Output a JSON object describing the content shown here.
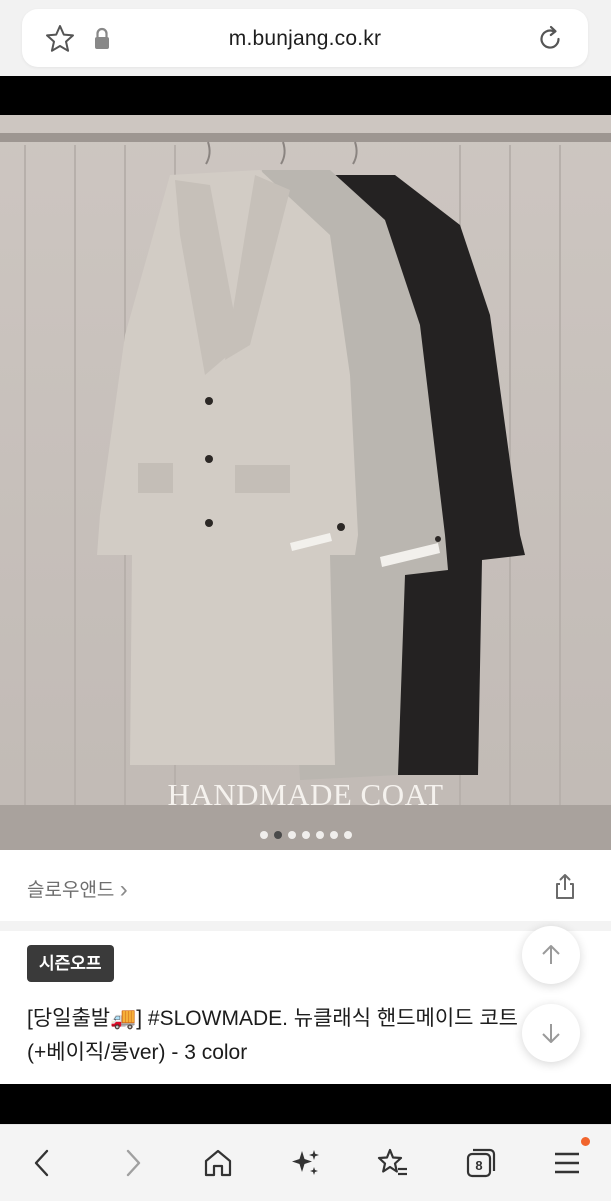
{
  "browser": {
    "url": "m.bunjang.co.kr",
    "tab_count": "8"
  },
  "hero": {
    "caption": "HANDMADE COAT",
    "slide_count": 7,
    "active_slide_index": 1
  },
  "shop": {
    "name": "슬로우앤드",
    "chevron": "›"
  },
  "product": {
    "badge": "시즌오프",
    "title": "[당일출발🚚] #SLOWMADE. 뉴클래식 핸드메이드 코트 (+베이직/롱ver) - 3 color"
  },
  "icons": {
    "favorite": "star-outline-icon",
    "lock": "lock-icon",
    "reload": "reload-icon",
    "share": "share-icon",
    "scroll_up": "arrow-up-icon",
    "scroll_down": "arrow-down-icon",
    "back": "chevron-left-icon",
    "forward": "chevron-right-icon",
    "home": "home-icon",
    "sparkle": "sparkle-icon",
    "bookmark": "star-list-icon",
    "tabs": "tabs-icon",
    "menu": "menu-icon"
  },
  "colors": {
    "notification_dot": "#f1642c",
    "badge_bg": "#3a3a3a"
  }
}
